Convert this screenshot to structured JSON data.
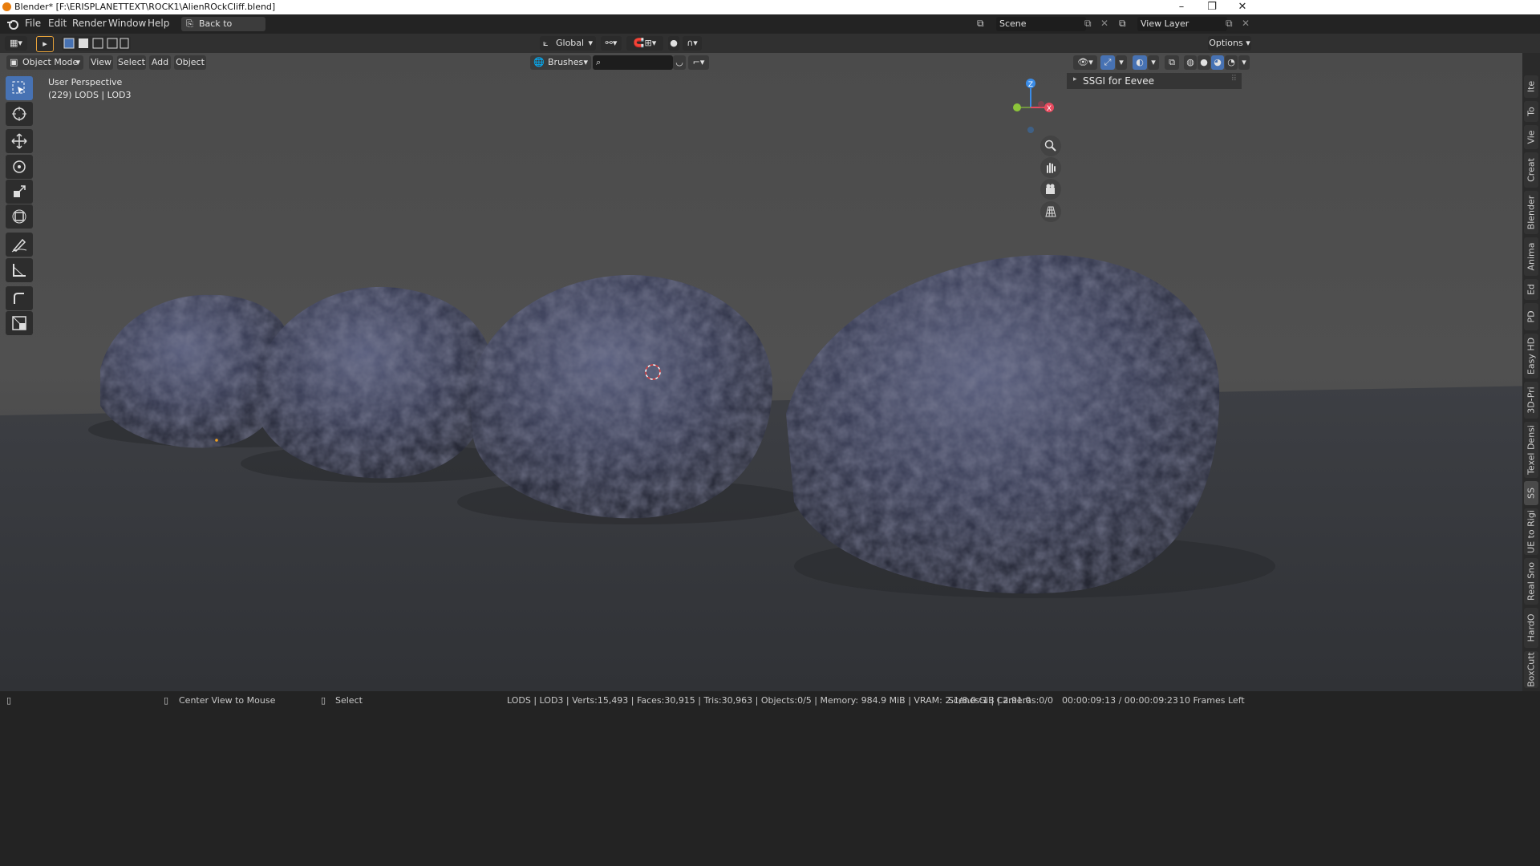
{
  "window": {
    "title": "Blender* [F:\\ERISPLANETTEXT\\ROCK1\\AlienROckCliff.blend]",
    "controls": [
      "–",
      "❐",
      "✕"
    ]
  },
  "menubar": {
    "items": [
      "File",
      "Edit",
      "Render",
      "Window",
      "Help"
    ],
    "back_button": "Back to Previous",
    "scene_label": "Scene",
    "view_layer_label": "View Layer"
  },
  "tool_header": {
    "transform_orientation": "Global",
    "options_label": "Options"
  },
  "viewport_header": {
    "mode": "Object Mode",
    "menus": [
      "View",
      "Select",
      "Add",
      "Object"
    ],
    "brushes_label": "Brushes",
    "search_placeholder": ""
  },
  "viewport": {
    "perspective_label": "User Perspective",
    "collection_label": "(229) LODS | LOD3",
    "gizmo_axes": [
      "Z",
      "X"
    ]
  },
  "sidebar_panel": {
    "panel_title": "SSGI for Eevee"
  },
  "sidebar_tabs": [
    "Ite",
    "To",
    "Vie",
    "Creat",
    "Blender",
    "Anima",
    "Ed",
    "PD",
    "Easy HD",
    "3D-Pri",
    "Texel Densi",
    "SS",
    "UE to Rigi",
    "Real Sno",
    "HardO",
    "BoxCutt"
  ],
  "statusbar": {
    "hint_center": "Center View to Mouse",
    "hint_select": "Select",
    "stats": "LODS | LOD3 | Verts:15,493 | Faces:30,915 | Tris:30,963 | Objects:0/5 | Memory: 984.9 MiB | VRAM: 2.1/8.0 GiB | 2.91.0",
    "scenes": "Scenes:1 | Cameras:0/0",
    "time": "00:00:09:13 / 00:00:09:23",
    "frames_left": "10 Frames Left"
  },
  "colors": {
    "accent": "#4772b3",
    "axis_x": "#e84a5f",
    "axis_y": "#8cc43a",
    "axis_z": "#3a8ce8",
    "rock": "#3c4058"
  }
}
